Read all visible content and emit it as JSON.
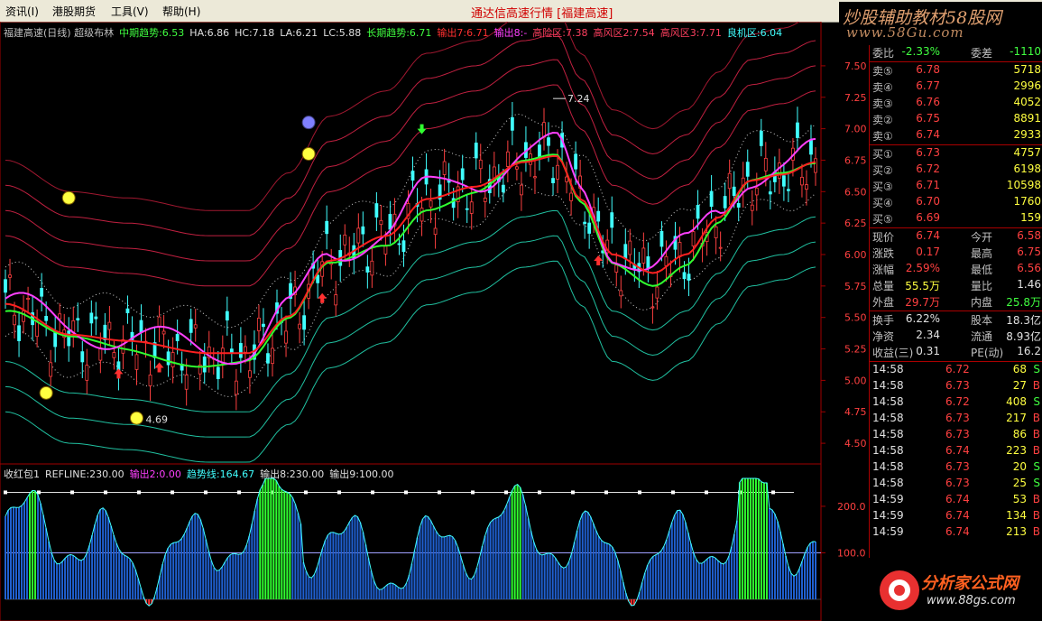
{
  "menu": {
    "items": [
      "资讯(I)",
      "港股期货",
      "工具(V)",
      "帮助(H)"
    ]
  },
  "window_title": "通达信高速行情 [福建高速]",
  "brand": {
    "top": "炒股辅助教材58股网",
    "bottom": "www.58Gu.com"
  },
  "watermark": {
    "title": "分析家公式网",
    "url": "www.88gs.com"
  },
  "main_info": [
    {
      "text": "福建高速(日线) 超级布林",
      "color": "#c0c0c0"
    },
    {
      "text": "中期趋势:6.53",
      "color": "#40ff40"
    },
    {
      "text": "HA:6.86",
      "color": "#e0e0e0"
    },
    {
      "text": "HC:7.18",
      "color": "#e0e0e0"
    },
    {
      "text": "LA:6.21",
      "color": "#e0e0e0"
    },
    {
      "text": "LC:5.88",
      "color": "#e0e0e0"
    },
    {
      "text": "长期趋势:6.71",
      "color": "#40ff40"
    },
    {
      "text": "输出7:6.71",
      "color": "#ff3030"
    },
    {
      "text": "输出8:-",
      "color": "#ff40ff"
    },
    {
      "text": "高险区:7.38",
      "color": "#ff4060"
    },
    {
      "text": "高风区2:7.54",
      "color": "#ff4060"
    },
    {
      "text": "高风区3:7.71",
      "color": "#ff4060"
    },
    {
      "text": "良机区:6.04",
      "color": "#40ffff"
    }
  ],
  "price_axis": [
    "7.50",
    "7.25",
    "7.00",
    "6.75",
    "6.50",
    "6.25",
    "6.00",
    "5.75",
    "5.50",
    "5.25",
    "5.00",
    "4.75",
    "4.50"
  ],
  "annotations": {
    "high": "7.24",
    "low": "4.69"
  },
  "indicator_info": [
    {
      "text": "收红包1",
      "color": "#e0e0e0"
    },
    {
      "text": "REFLINE:230.00",
      "color": "#e0e0e0"
    },
    {
      "text": "输出2:0.00",
      "color": "#ff40ff"
    },
    {
      "text": "趋势线:164.67",
      "color": "#40ffff"
    },
    {
      "text": "输出8:230.00",
      "color": "#e0e0e0"
    },
    {
      "text": "输出9:100.00",
      "color": "#e0e0e0"
    }
  ],
  "indicator_axis": [
    "200.0",
    "100.0"
  ],
  "quote": {
    "ratio": {
      "l1": "委比",
      "v1": "-2.33%",
      "l2": "委差",
      "v2": "-1110"
    },
    "asks": [
      {
        "label": "卖⑤",
        "price": "6.78",
        "vol": "5718"
      },
      {
        "label": "卖④",
        "price": "6.77",
        "vol": "2996"
      },
      {
        "label": "卖③",
        "price": "6.76",
        "vol": "4052"
      },
      {
        "label": "卖②",
        "price": "6.75",
        "vol": "8891"
      },
      {
        "label": "卖①",
        "price": "6.74",
        "vol": "2933"
      }
    ],
    "bids": [
      {
        "label": "买①",
        "price": "6.73",
        "vol": "4757"
      },
      {
        "label": "买②",
        "price": "6.72",
        "vol": "6198"
      },
      {
        "label": "买③",
        "price": "6.71",
        "vol": "10598"
      },
      {
        "label": "买④",
        "price": "6.70",
        "vol": "1760"
      },
      {
        "label": "买⑤",
        "price": "6.69",
        "vol": "159"
      }
    ],
    "stats": [
      {
        "l1": "现价",
        "v1": "6.74",
        "l2": "今开",
        "v2": "6.58"
      },
      {
        "l1": "涨跌",
        "v1": "0.17",
        "l2": "最高",
        "v2": "6.75"
      },
      {
        "l1": "涨幅",
        "v1": "2.59%",
        "l2": "最低",
        "v2": "6.56"
      },
      {
        "l1": "总量",
        "v1": "55.5万",
        "l2": "量比",
        "v2": "1.46"
      },
      {
        "l1": "外盘",
        "v1": "29.7万",
        "l2": "内盘",
        "v2": "25.8万"
      }
    ],
    "stats2": [
      {
        "l1": "换手",
        "v1": "6.22%",
        "l2": "股本",
        "v2": "18.3亿"
      },
      {
        "l1": "净资",
        "v1": "2.34",
        "l2": "流通",
        "v2": "8.93亿"
      },
      {
        "l1": "收益(三)",
        "v1": "0.31",
        "l2": "PE(动)",
        "v2": "16.2"
      }
    ],
    "ticks": [
      {
        "time": "14:58",
        "price": "6.72",
        "vol": "68",
        "side": "S"
      },
      {
        "time": "14:58",
        "price": "6.73",
        "vol": "27",
        "side": "B"
      },
      {
        "time": "14:58",
        "price": "6.72",
        "vol": "408",
        "side": "S"
      },
      {
        "time": "14:58",
        "price": "6.73",
        "vol": "217",
        "side": "B"
      },
      {
        "time": "14:58",
        "price": "6.73",
        "vol": "86",
        "side": "B"
      },
      {
        "time": "14:58",
        "price": "6.74",
        "vol": "223",
        "side": "B"
      },
      {
        "time": "14:58",
        "price": "6.73",
        "vol": "20",
        "side": "S"
      },
      {
        "time": "14:58",
        "price": "6.73",
        "vol": "25",
        "side": "S"
      },
      {
        "time": "14:59",
        "price": "6.74",
        "vol": "53",
        "side": "B"
      },
      {
        "time": "14:59",
        "price": "6.74",
        "vol": "134",
        "side": "B"
      },
      {
        "time": "14:59",
        "price": "6.74",
        "vol": "213",
        "side": "B"
      }
    ]
  },
  "colors": {
    "up": "#ff4040",
    "down": "#40ff40",
    "neutral": "#e0e0e0",
    "volume": "#ffff40",
    "border": "#a00000"
  }
}
